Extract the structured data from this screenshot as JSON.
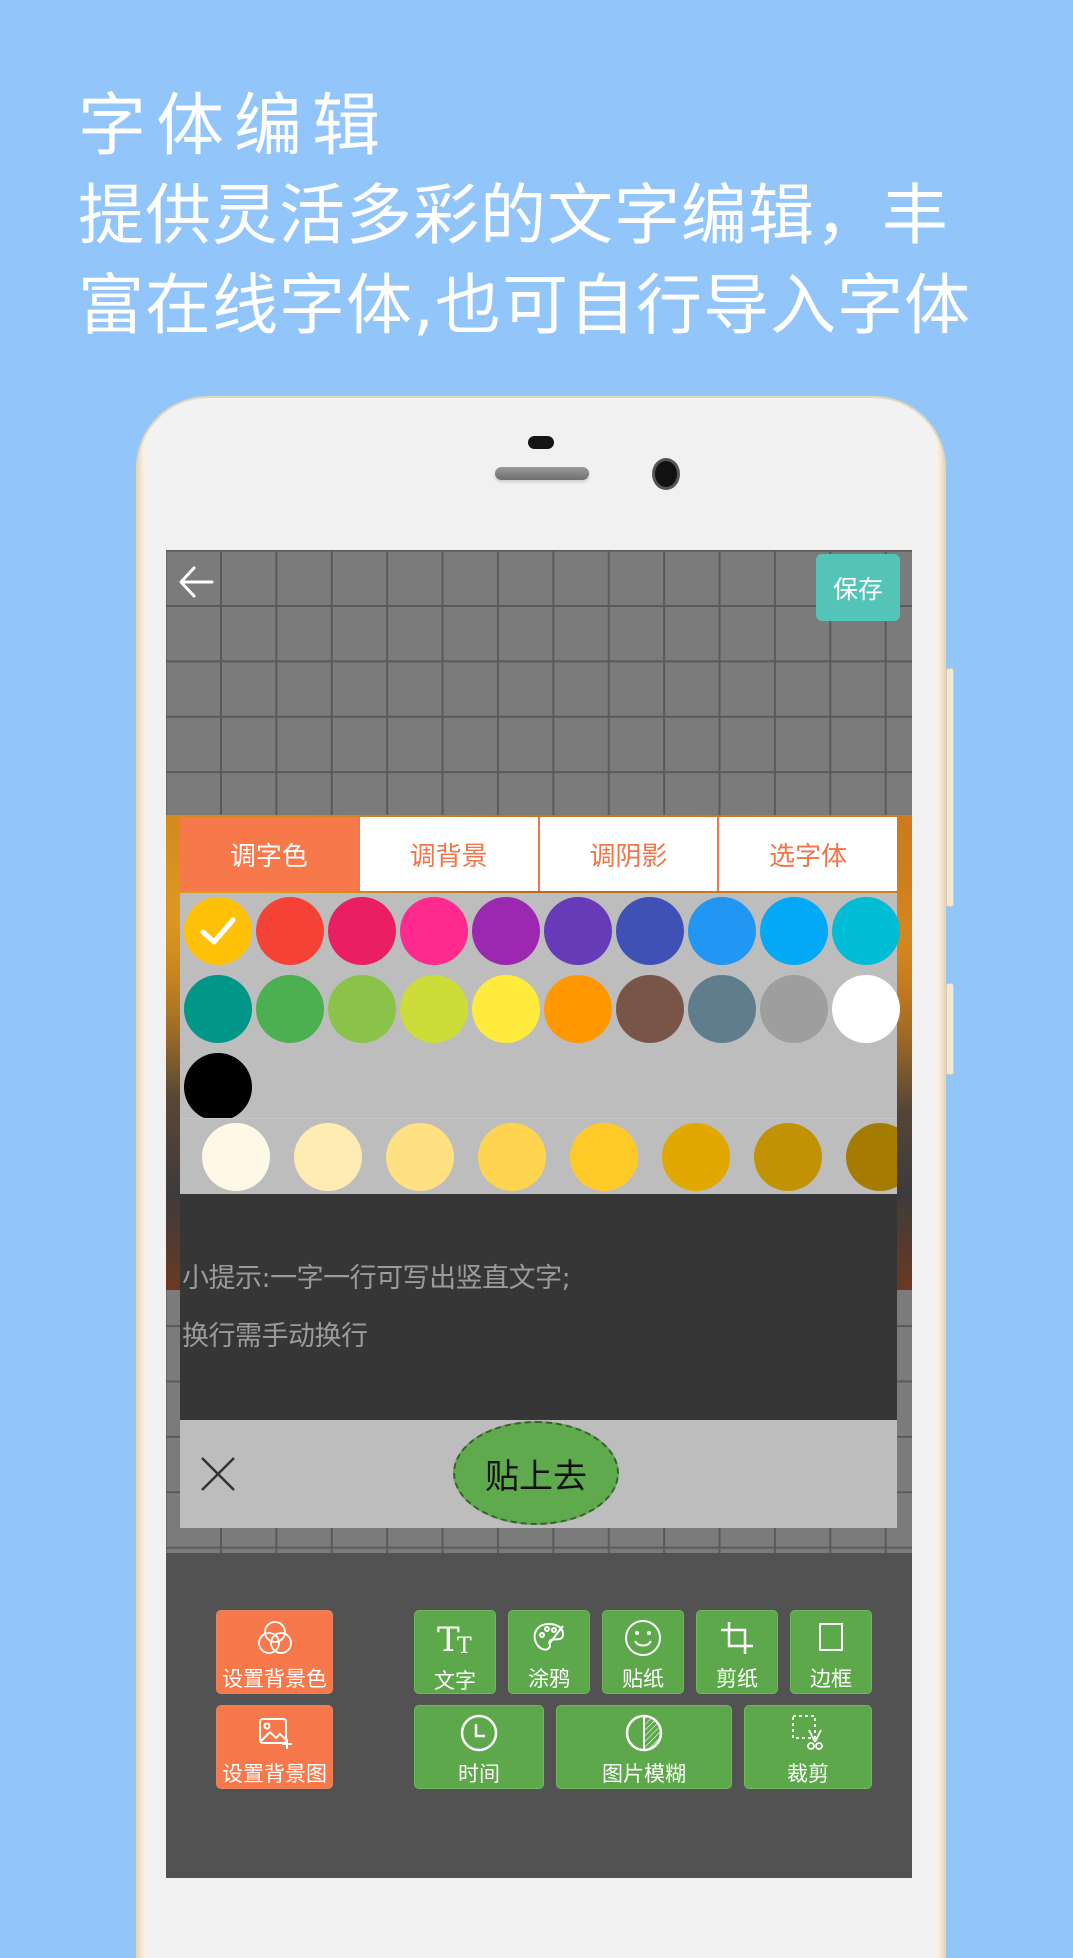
{
  "promo": {
    "title": "字体编辑",
    "line1": "提供灵活多彩的文字编辑，丰",
    "line2": "富在线字体,也可自行导入字体"
  },
  "colors": {
    "background": "#92C6FB",
    "accent_orange": "#F7784B",
    "accent_green": "#5EA84C",
    "save_teal": "#53C4B7"
  },
  "topbar": {
    "back_icon": "arrow-left-icon",
    "save_label": "保存"
  },
  "editor": {
    "tabs": [
      {
        "label": "调字色",
        "active": true
      },
      {
        "label": "调背景",
        "active": false
      },
      {
        "label": "调阴影",
        "active": false
      },
      {
        "label": "选字体",
        "active": false
      }
    ],
    "palette": [
      {
        "color": "#FFC107",
        "selected": true
      },
      {
        "color": "#F44336",
        "selected": false
      },
      {
        "color": "#E91E63",
        "selected": false
      },
      {
        "color": "#FF2A8E",
        "selected": false
      },
      {
        "color": "#9C27B0",
        "selected": false
      },
      {
        "color": "#673AB7",
        "selected": false
      },
      {
        "color": "#3F51B5",
        "selected": false
      },
      {
        "color": "#2196F3",
        "selected": false
      },
      {
        "color": "#03A9F4",
        "selected": false
      },
      {
        "color": "#00BCD4",
        "selected": false
      },
      {
        "color": "#009688",
        "selected": false
      },
      {
        "color": "#4CAF50",
        "selected": false
      },
      {
        "color": "#8BC34A",
        "selected": false
      },
      {
        "color": "#CDDC39",
        "selected": false
      },
      {
        "color": "#FFEB3B",
        "selected": false
      },
      {
        "color": "#FF9800",
        "selected": false
      },
      {
        "color": "#795548",
        "selected": false
      },
      {
        "color": "#607D8B",
        "selected": false
      },
      {
        "color": "#9E9E9E",
        "selected": false
      },
      {
        "color": "#FFFFFF",
        "selected": false
      },
      {
        "color": "#000000",
        "selected": false
      }
    ],
    "shades": [
      "#FFF8E7",
      "#FFECB3",
      "#FFE082",
      "#FFD54F",
      "#FFCA28",
      "#E0A800",
      "#C29205",
      "#A67C00"
    ],
    "hint_line1": "小提示:一字一行可写出竖直文字;",
    "hint_line2": "换行需手动换行",
    "close_icon": "close-x-icon",
    "paste_label": "贴上去"
  },
  "toolbar": {
    "left": [
      {
        "label": "设置背景色",
        "icon": "color-circles-icon"
      },
      {
        "label": "设置背景图",
        "icon": "image-add-icon"
      }
    ],
    "row1": [
      {
        "label": "文字",
        "icon": "text-tt-icon"
      },
      {
        "label": "涂鸦",
        "icon": "palette-icon"
      },
      {
        "label": "贴纸",
        "icon": "smiley-icon"
      },
      {
        "label": "剪纸",
        "icon": "crop-icon"
      },
      {
        "label": "边框",
        "icon": "border-square-icon"
      }
    ],
    "row2": [
      {
        "label": "时间",
        "icon": "clock-icon"
      },
      {
        "label": "图片模糊",
        "icon": "blur-half-circle-icon"
      },
      {
        "label": "裁剪",
        "icon": "cut-selection-icon"
      }
    ]
  }
}
